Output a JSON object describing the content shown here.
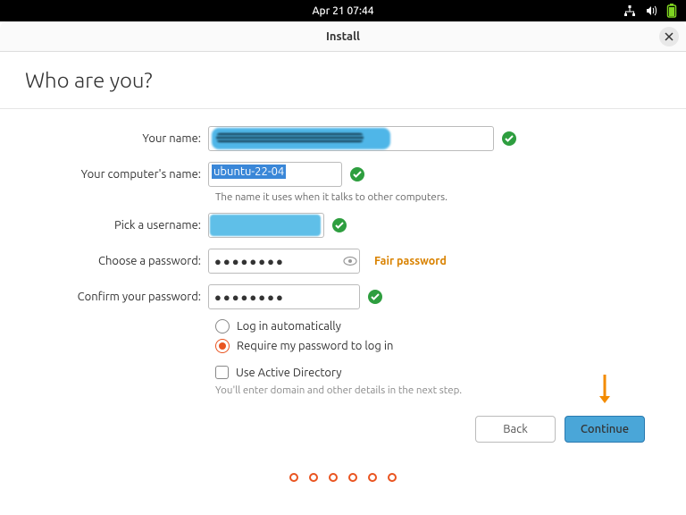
{
  "topbar": {
    "datetime": "Apr 21  07:44"
  },
  "window": {
    "title": "Install"
  },
  "page": {
    "heading": "Who are you?"
  },
  "form": {
    "name": {
      "label": "Your name:",
      "value": ""
    },
    "computer": {
      "label": "Your computer's name:",
      "value": "ubuntu-22-04",
      "hint": "The name it uses when it talks to other computers."
    },
    "username": {
      "label": "Pick a username:",
      "value": ""
    },
    "password": {
      "label": "Choose a password:",
      "value": "●●●●●●●●",
      "strength": "Fair password"
    },
    "confirm": {
      "label": "Confirm your password:",
      "value": "●●●●●●●●"
    },
    "login_auto": "Log in automatically",
    "login_require": "Require my password to log in",
    "ad": {
      "label": "Use Active Directory",
      "hint": "You'll enter domain and other details in the next step."
    }
  },
  "footer": {
    "back": "Back",
    "continue": "Continue"
  },
  "colors": {
    "accent": "#e95420",
    "highlight": "#4aa6d8",
    "warn": "#d98200"
  }
}
